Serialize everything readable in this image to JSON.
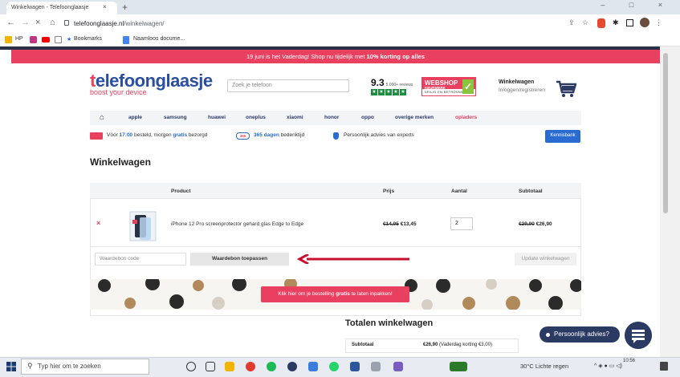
{
  "browser": {
    "tab_title": "Winkelwagen - Telefoonglaasje",
    "tab_close": "×",
    "new_tab": "+",
    "window_controls": "–  □  ×",
    "nav": {
      "back": "←",
      "forward": "→",
      "reload": "×",
      "home": "⌂"
    },
    "url_domain": "telefoonglaasje.nl",
    "url_path": "/winkelwagen/",
    "bookmarks": [
      "HP",
      "Bookmarks",
      "Naamloos docume..."
    ]
  },
  "promo": {
    "text_before": "19 juni is het Vaderdag! Shop nu tijdelijk met ",
    "text_bold": "10% korting op alles"
  },
  "header": {
    "logo_prefix": "t",
    "logo_rest": "elefoonglaasje",
    "logo_sub": "boost your device",
    "search_placeholder": "Zoek je telefoon",
    "rating_score": "9.3",
    "rating_count": "5.000+ reviews",
    "keurmerk_top": "WEBSHOP",
    "keurmerk_mid": "KEURMERK",
    "keurmerk_sub": "VEILIG EN BETROUWBAAR",
    "cart_title": "Winkelwagen",
    "cart_login": "Inloggen/registreren"
  },
  "nav": {
    "home_icon": "⌂",
    "items": [
      "apple",
      "samsung",
      "huawei",
      "oneplus",
      "xiaomi",
      "honor",
      "oppo",
      "overige merken",
      "opladers"
    ]
  },
  "usp": {
    "delivery_before": "Vóór ",
    "delivery_time": "17:00",
    "delivery_mid": " besteld, morgen ",
    "delivery_free": "gratis",
    "delivery_after": " bezorgd",
    "days_badge": "365",
    "days_text": "365 dagen",
    "days_after": " bedenktijd",
    "advice": "Persoonlijk advies van experts",
    "kennisbank": "Kennisbank"
  },
  "page_title": "Winkelwagen",
  "cart": {
    "headers": {
      "product": "Product",
      "price": "Prijs",
      "qty": "Aantal",
      "subtotal": "Subtotaal"
    },
    "remove": "×",
    "item": {
      "name": "iPhone 12 Pro screenprotector gehard glas Edge to Edge",
      "old_price": "€14,95",
      "new_price": "€13,45",
      "qty": "2",
      "old_subtotal": "€29,90",
      "new_subtotal": "€26,90"
    },
    "coupon_placeholder": "Waardebon code",
    "coupon_button": "Waardebon toepassen",
    "update_button": "Update winkelwagen"
  },
  "gift": {
    "before": "Klik hier om je bestelling ",
    "bold": "gratis",
    "after": " te laten inpakken!"
  },
  "totals": {
    "title": "Totalen winkelwagen",
    "subtotal_label": "Subtotaal",
    "subtotal_value": "€26,90",
    "subtotal_note": " (Vaderdag korting €3,00)"
  },
  "chat": {
    "label": "Persoonlijk advies?"
  },
  "taskbar": {
    "search_placeholder": "Typ hier om te zoeken",
    "weather": "30°C  Lichte regen",
    "time": "10:56"
  },
  "colors": {
    "brand_pink": "#e9405f",
    "brand_blue": "#2a4fa0",
    "navy": "#2b3a63"
  }
}
